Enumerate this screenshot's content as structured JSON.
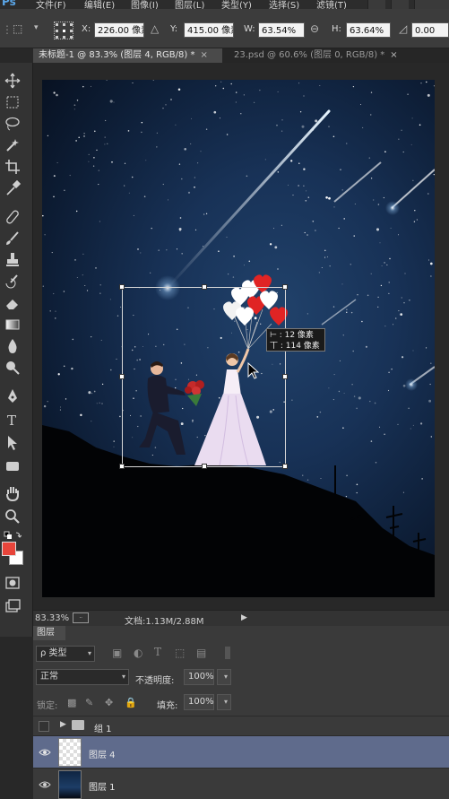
{
  "app": {
    "logo": "Ps"
  },
  "menu": [
    "文件(F)",
    "编辑(E)",
    "图像(I)",
    "图层(L)",
    "类型(Y)",
    "选择(S)",
    "滤镜(T)"
  ],
  "options": {
    "x_label": "X:",
    "x_value": "226.00 像素",
    "y_label": "Y:",
    "y_value": "415.00 像素",
    "w_label": "W:",
    "w_value": "63.54%",
    "h_label": "H:",
    "h_value": "63.64%",
    "angle_value": "0.00"
  },
  "tabs": [
    {
      "label": "未标题-1 @ 83.3% (图层 4, RGB/8) *",
      "close": "×"
    },
    {
      "label": "23.psd @ 60.6% (图层 0, RGB/8) *",
      "close": "×"
    }
  ],
  "tooltip": {
    "h_offset": "⊢ :  12 像素",
    "v_offset": "丅 : 114 像素"
  },
  "status": {
    "zoom": "83.33%",
    "doc": "文档:1.13M/2.88M"
  },
  "layers_panel": {
    "title": "图层",
    "filter_kind": "ρ 类型",
    "blend_mode": "正常",
    "opacity_label": "不透明度:",
    "opacity_value": "100%",
    "lock_label": "锁定:",
    "fill_label": "填充:",
    "fill_value": "100%",
    "layers": [
      {
        "name": "组 1"
      },
      {
        "name": "图层 4"
      },
      {
        "name": "图层 1"
      }
    ]
  },
  "colors": {
    "foreground": "#e8453b",
    "background": "#ffffff",
    "selected_layer": "#5f6b8c"
  }
}
